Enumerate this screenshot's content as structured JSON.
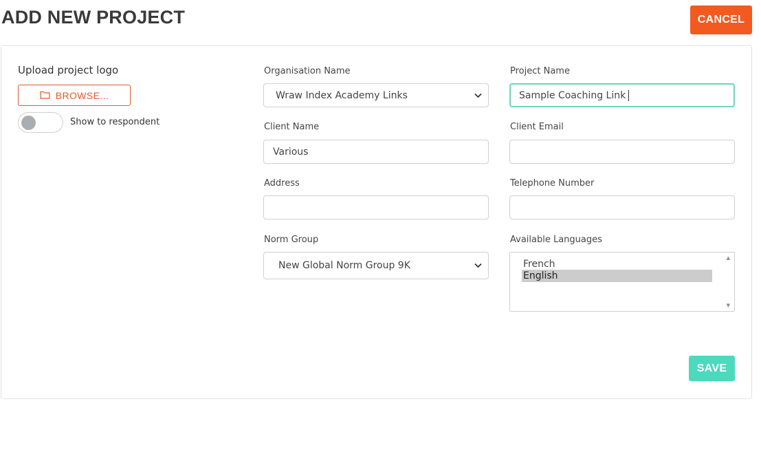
{
  "header": {
    "title": "ADD NEW PROJECT",
    "cancel_label": "CANCEL",
    "cancel_color": "#f25a1f"
  },
  "logo": {
    "label": "Upload project logo",
    "browse_label": "BROWSE...",
    "browse_icon": "folder-icon",
    "toggle_label": "Show to respondent",
    "toggle_on": false
  },
  "form": {
    "organisation_name": {
      "label": "Organisation Name",
      "value": "Wraw Index Academy Links"
    },
    "project_name": {
      "label": "Project Name",
      "value": "Sample Coaching Link"
    },
    "client_name": {
      "label": "Client Name",
      "value": "Various"
    },
    "client_email": {
      "label": "Client Email",
      "value": ""
    },
    "address": {
      "label": "Address",
      "value": ""
    },
    "telephone": {
      "label": "Telephone Number",
      "value": ""
    },
    "norm_group": {
      "label": "Norm Group",
      "value": "New Global Norm Group 9K"
    },
    "languages": {
      "label": "Available Languages",
      "options": [
        "French",
        "English"
      ],
      "selected": "English"
    }
  },
  "actions": {
    "save_label": "SAVE",
    "save_color": "#4dd9bd"
  }
}
